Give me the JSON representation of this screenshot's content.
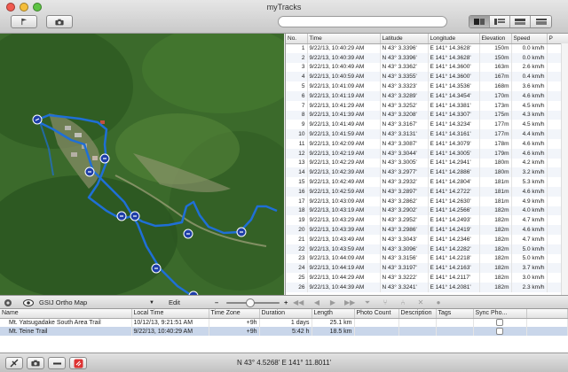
{
  "window": {
    "title": "myTracks"
  },
  "toolbar": {
    "flag_icon": "flag-icon",
    "camera_icon": "camera-icon",
    "search_placeholder": "",
    "view_modes": [
      "map-and-list",
      "list-sidebar",
      "list-table",
      "list-graph"
    ]
  },
  "table": {
    "columns": [
      "No.",
      "Time",
      "Latitude",
      "Longitude",
      "Elevation",
      "Speed",
      "P"
    ],
    "rows": [
      [
        "1",
        "9/22/13, 10:40:29 AM",
        "N 43° 3.3396'",
        "E 141° 14.3628'",
        "150m",
        "0.0 km/h"
      ],
      [
        "2",
        "9/22/13, 10:40:39 AM",
        "N 43° 3.3396'",
        "E 141° 14.3628'",
        "150m",
        "0.0 km/h"
      ],
      [
        "3",
        "9/22/13, 10:40:49 AM",
        "N 43° 3.3362'",
        "E 141° 14.3600'",
        "163m",
        "2.6 km/h"
      ],
      [
        "4",
        "9/22/13, 10:40:59 AM",
        "N 43° 3.3355'",
        "E 141° 14.3600'",
        "167m",
        "0.4 km/h"
      ],
      [
        "5",
        "9/22/13, 10:41:09 AM",
        "N 43° 3.3323'",
        "E 141° 14.3536'",
        "168m",
        "3.6 km/h"
      ],
      [
        "6",
        "9/22/13, 10:41:19 AM",
        "N 43° 3.3289'",
        "E 141° 14.3454'",
        "170m",
        "4.6 km/h"
      ],
      [
        "7",
        "9/22/13, 10:41:29 AM",
        "N 43° 3.3252'",
        "E 141° 14.3381'",
        "173m",
        "4.5 km/h"
      ],
      [
        "8",
        "9/22/13, 10:41:39 AM",
        "N 43° 3.3208'",
        "E 141° 14.3307'",
        "175m",
        "4.3 km/h"
      ],
      [
        "9",
        "9/22/13, 10:41:49 AM",
        "N 43° 3.3167'",
        "E 141° 14.3234'",
        "177m",
        "4.5 km/h"
      ],
      [
        "10",
        "9/22/13, 10:41:59 AM",
        "N 43° 3.3131'",
        "E 141° 14.3161'",
        "177m",
        "4.4 km/h"
      ],
      [
        "11",
        "9/22/13, 10:42:09 AM",
        "N 43° 3.3087'",
        "E 141° 14.3079'",
        "178m",
        "4.6 km/h"
      ],
      [
        "12",
        "9/22/13, 10:42:19 AM",
        "N 43° 3.3044'",
        "E 141° 14.3005'",
        "179m",
        "4.6 km/h"
      ],
      [
        "13",
        "9/22/13, 10:42:29 AM",
        "N 43° 3.3005'",
        "E 141° 14.2941'",
        "180m",
        "4.2 km/h"
      ],
      [
        "14",
        "9/22/13, 10:42:39 AM",
        "N 43° 3.2977'",
        "E 141° 14.2886'",
        "180m",
        "3.2 km/h"
      ],
      [
        "15",
        "9/22/13, 10:42:49 AM",
        "N 43° 3.2932'",
        "E 141° 14.2804'",
        "181m",
        "5.3 km/h"
      ],
      [
        "16",
        "9/22/13, 10:42:59 AM",
        "N 43° 3.2897'",
        "E 141° 14.2722'",
        "181m",
        "4.6 km/h"
      ],
      [
        "17",
        "9/22/13, 10:43:09 AM",
        "N 43° 3.2862'",
        "E 141° 14.2630'",
        "181m",
        "4.9 km/h"
      ],
      [
        "18",
        "9/22/13, 10:43:19 AM",
        "N 43° 3.2902'",
        "E 141° 14.2566'",
        "182m",
        "4.0 km/h"
      ],
      [
        "19",
        "9/22/13, 10:43:29 AM",
        "N 43° 3.2952'",
        "E 141° 14.2493'",
        "182m",
        "4.7 km/h"
      ],
      [
        "20",
        "9/22/13, 10:43:39 AM",
        "N 43° 3.2986'",
        "E 141° 14.2419'",
        "182m",
        "4.6 km/h"
      ],
      [
        "21",
        "9/22/13, 10:43:49 AM",
        "N 43° 3.3043'",
        "E 141° 14.2346'",
        "182m",
        "4.7 km/h"
      ],
      [
        "22",
        "9/22/13, 10:43:59 AM",
        "N 43° 3.3096'",
        "E 141° 14.2282'",
        "182m",
        "5.0 km/h"
      ],
      [
        "23",
        "9/22/13, 10:44:09 AM",
        "N 43° 3.3156'",
        "E 141° 14.2218'",
        "182m",
        "5.0 km/h"
      ],
      [
        "24",
        "9/22/13, 10:44:19 AM",
        "N 43° 3.3197'",
        "E 141° 14.2163'",
        "182m",
        "3.7 km/h"
      ],
      [
        "25",
        "9/22/13, 10:44:29 AM",
        "N 43° 3.3222'",
        "E 141° 14.2117'",
        "182m",
        "3.0 km/h"
      ],
      [
        "26",
        "9/22/13, 10:44:39 AM",
        "N 43° 3.3241'",
        "E 141° 14.2081'",
        "182m",
        "2.3 km/h"
      ]
    ]
  },
  "midbar": {
    "map_source": "GSIJ Ortho Map",
    "edit_label": "Edit",
    "zoom_minus": "–",
    "zoom_plus": "+",
    "zoom_level": 0.45
  },
  "tracks": {
    "columns": [
      "Name",
      "Local Time",
      "Time Zone",
      "Duration",
      "Length",
      "Photo Count",
      "Description",
      "Tags",
      "Sync Pho..."
    ],
    "rows": [
      {
        "name": "Mt. Yatsugadake South Area Trail",
        "local_time": "10/12/13, 9:21:51 AM",
        "time_zone": "+9h",
        "duration": "1 days",
        "length": "25.1 km",
        "photo_count": "",
        "description": "",
        "tags": ""
      },
      {
        "name": "Mt. Teine Trail",
        "local_time": "9/22/13, 10:40:29 AM",
        "time_zone": "+9h",
        "duration": "5:42 h",
        "length": "18.5 km",
        "photo_count": "",
        "description": "",
        "tags": ""
      }
    ]
  },
  "statusbar": {
    "coordinates": "N 43° 4.5268'  E 141° 11.8011'"
  },
  "colors": {
    "track": "#1f6fd6",
    "selected_row": "#c9d6ea",
    "forest_dark": "#2f5a22"
  }
}
